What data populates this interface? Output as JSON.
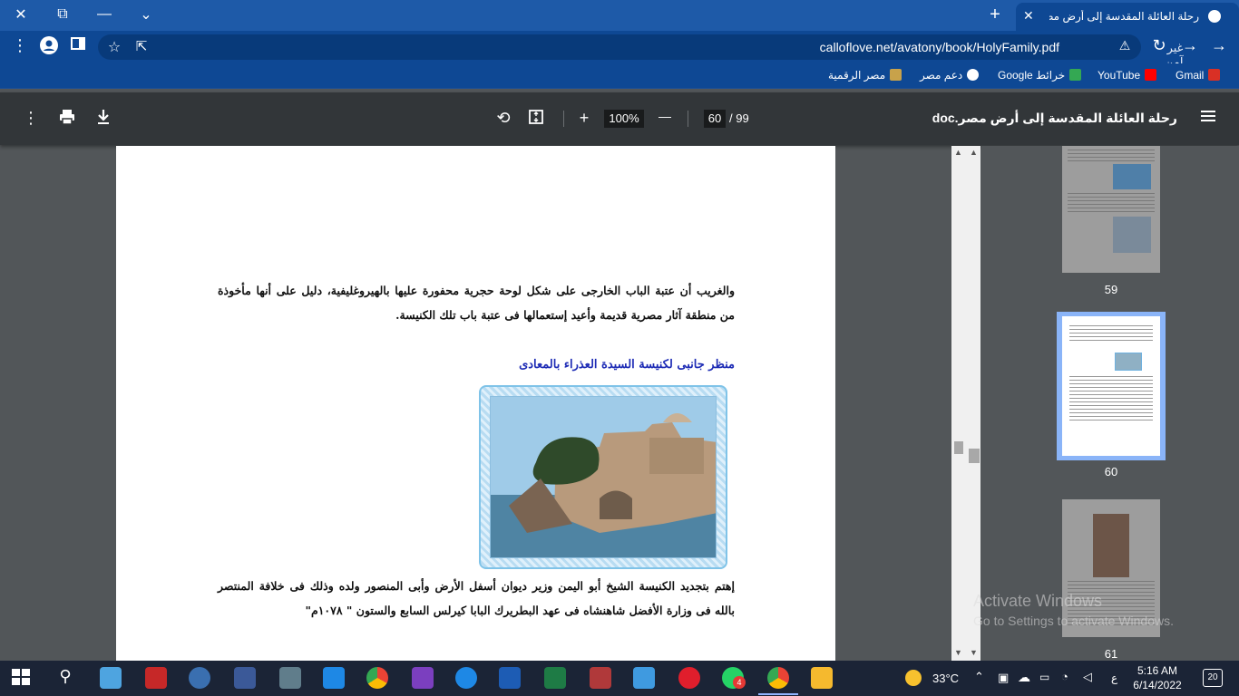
{
  "tab": {
    "title": "رحلة العائلة المقدسة إلى أرض مصر",
    "close": "✕",
    "new_tab": "+"
  },
  "window_controls": {
    "close": "✕",
    "restore": "⧉",
    "minimize": "—",
    "tab_search": "⌄"
  },
  "address": {
    "url": "calloflove.net/avatony/book/HolyFamily.pdf",
    "security_label": "غير آمن"
  },
  "bookmarks": [
    {
      "label": "Gmail",
      "color": "#d93025"
    },
    {
      "label": "YouTube",
      "color": "#ff0000"
    },
    {
      "label": "خرائط Google",
      "color": "#34a853"
    },
    {
      "label": "دعم مصر",
      "color": "#ffffff"
    },
    {
      "label": "مصر الرقمية",
      "color": "#c8a24a"
    }
  ],
  "pdf": {
    "title": "رحلة العائلة المقدسة إلى أرض مصر.doc",
    "current_page": "60",
    "total_pages": "/ 99",
    "zoom": "100%",
    "zoom_in": "+",
    "zoom_out": "—"
  },
  "document": {
    "paragraph1": "والغريب أن عتبة الباب الخارجى على شكل لوحة حجرية محفورة عليها بالهيروغليفية، دليل على أنها مأخوذة من منطقة آثار مصرية قديمة وأعيد إستعمالها فى عتبة باب تلك الكنيسة.",
    "caption": "منظر جانبى لكنيسة السيدة العذراء بالمعادى",
    "paragraph2": "إهتم بتجديد الكنيسة الشيخ أبو اليمن وزير ديوان أسفل الأرض وأبى المنصور ولده وذلك فى خلافة المنتصر بالله فى وزارة الأفضل شاهنشاه فى عهد البطريرك البابا كيرلس السابع والستون \" ١٠٧٨م\""
  },
  "thumbnails": [
    {
      "label": "59"
    },
    {
      "label": "60"
    },
    {
      "label": "61"
    }
  ],
  "watermark": {
    "line1": "Activate Windows",
    "line2": "Go to Settings to activate Windows."
  },
  "taskbar": {
    "temperature": "33°C",
    "time": "5:16 AM",
    "date": "6/14/2022",
    "notifications": "20",
    "lang": "ع",
    "whatsapp_badge": "4"
  }
}
